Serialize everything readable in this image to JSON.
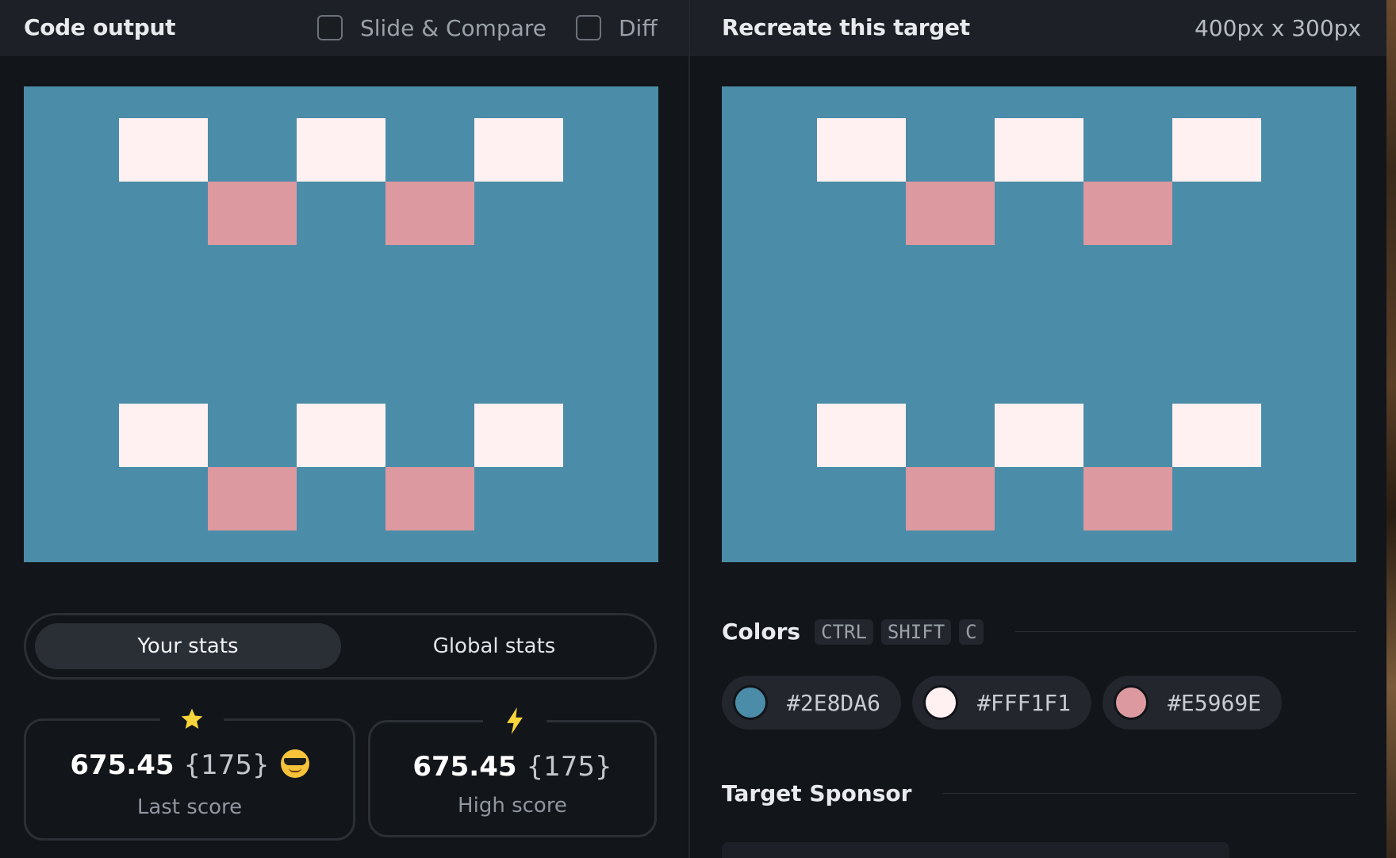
{
  "left_panel": {
    "title": "Code output",
    "slide_compare_label": "Slide & Compare",
    "diff_label": "Diff"
  },
  "right_panel": {
    "title": "Recreate this target",
    "dimensions": "400px x 300px"
  },
  "canvas": {
    "background": "#4B8CA8",
    "white_block_color": "#FFF1F1",
    "pink_block_color": "#DC9AA0"
  },
  "stats": {
    "tab_active": "Your stats",
    "tab_inactive": "Global stats",
    "last": {
      "score": "675.45",
      "count": "{175}",
      "label": "Last score",
      "icon": "star-icon"
    },
    "high": {
      "score": "675.45",
      "count": "{175}",
      "label": "High score",
      "icon": "lightning-icon"
    }
  },
  "colors": {
    "title": "Colors",
    "shortcut": [
      "CTRL",
      "SHIFT",
      "C"
    ],
    "swatches": [
      {
        "hex": "#2E8DA6",
        "display": "#4B8CA8"
      },
      {
        "hex": "#FFF1F1",
        "display": "#FFF1F1"
      },
      {
        "hex": "#E5969E",
        "display": "#DC9AA0"
      }
    ]
  },
  "sponsor": {
    "title": "Target Sponsor"
  }
}
